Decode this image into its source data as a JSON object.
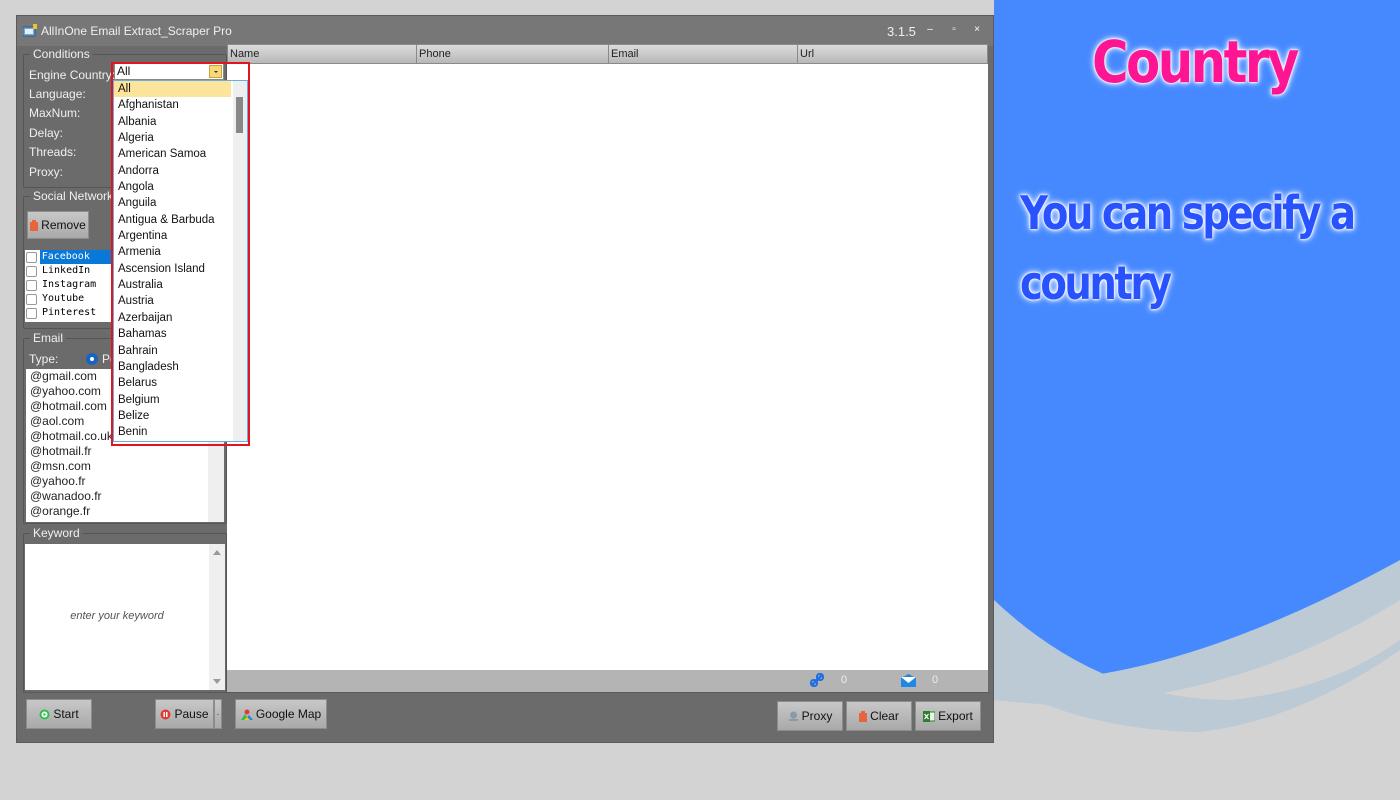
{
  "window": {
    "title": "AllInOne Email Extract_Scraper Pro",
    "version": "3.1.5",
    "controls": {
      "minimize": "–",
      "maximize": "▫",
      "close": "×"
    }
  },
  "conditions": {
    "legend": "Conditions",
    "labels": [
      "Engine Country:",
      "Language:",
      "MaxNum:",
      "Delay:",
      "Threads:",
      "Proxy:"
    ],
    "engine_country": {
      "value": "All",
      "options": [
        "All",
        "Afghanistan",
        "Albania",
        "Algeria",
        "American Samoa",
        "Andorra",
        "Angola",
        "Anguila",
        "Antigua & Barbuda",
        "Argentina",
        "Armenia",
        "Ascension Island",
        "Australia",
        "Austria",
        "Azerbaijan",
        "Bahamas",
        "Bahrain",
        "Bangladesh",
        "Belarus",
        "Belgium",
        "Belize",
        "Benin"
      ],
      "selected_index": 0
    }
  },
  "social": {
    "legend": "Social Network",
    "remove_label": "Remove",
    "items": [
      {
        "label": "Facebook",
        "checked": false,
        "selected": true
      },
      {
        "label": "LinkedIn",
        "checked": false,
        "selected": false
      },
      {
        "label": "Instagram",
        "checked": false,
        "selected": false
      },
      {
        "label": "Youtube",
        "checked": false,
        "selected": false
      },
      {
        "label": "Pinterest",
        "checked": false,
        "selected": false
      }
    ]
  },
  "email": {
    "legend": "Email",
    "type_label": "Type:",
    "type_value_partial": "Pe",
    "domains": [
      "@gmail.com",
      "@yahoo.com",
      "@hotmail.com",
      "@aol.com",
      "@hotmail.co.uk",
      "@hotmail.fr",
      "@msn.com",
      "@yahoo.fr",
      "@wanadoo.fr",
      "@orange.fr"
    ]
  },
  "keyword": {
    "legend": "Keyword",
    "placeholder": "enter your keyword"
  },
  "table": {
    "columns": [
      "Name",
      "Phone",
      "Email",
      "Url"
    ],
    "rows": []
  },
  "status": {
    "url_count": "0",
    "email_count": "0"
  },
  "buttons": {
    "start": "Start",
    "pause": "Pause",
    "google_map": "Google Map",
    "proxy": "Proxy",
    "clear": "Clear",
    "export": "Export"
  },
  "promo": {
    "title": "Country",
    "subtitle": "You can specify a country"
  },
  "colors": {
    "accent_red": "#e3141e",
    "promo_pink": "#ff1493",
    "promo_blue": "#2952ff",
    "bg_blue": "#4689ff",
    "selection_blue": "#0a78d7",
    "dropdown_highlight": "#fde49b"
  }
}
